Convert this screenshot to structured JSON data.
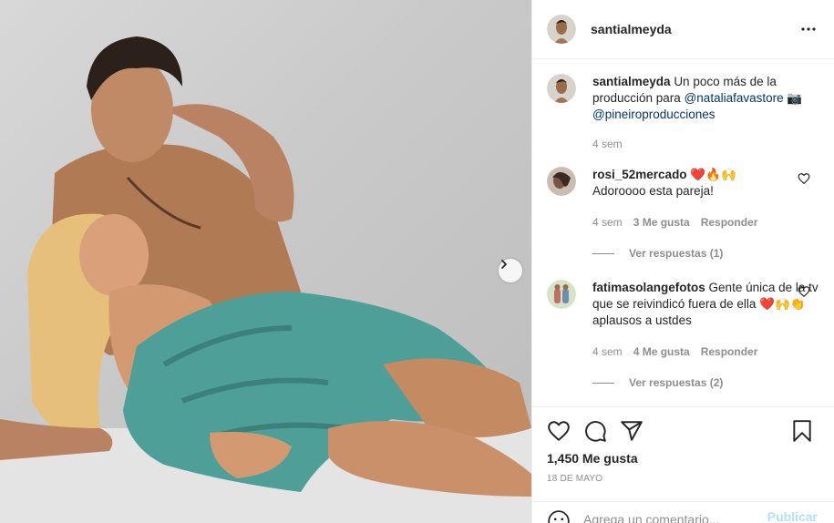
{
  "post": {
    "photo_alt": "",
    "author": "santialmeyda"
  },
  "header": {
    "username": "santialmeyda"
  },
  "caption": {
    "username": "santialmeyda",
    "text": "Un poco más de la producción para",
    "mention1": "@nataliafavastore",
    "emoji": "📷",
    "mention2": "@pineiroproducciones",
    "time": "4 sem"
  },
  "comments": [
    {
      "username": "rosi_52mercado",
      "emojis": "❤️🔥🙌",
      "text": "Adoroooo esta pareja!",
      "time": "4 sem",
      "likes": "3 Me gusta",
      "reply": "Responder",
      "view_replies": "Ver respuestas (1)"
    },
    {
      "username": "fatimasolangefotos",
      "text": "Gente única de la tv que se reivindicó fuera de ella",
      "emojis": "❤️🙌👏",
      "text_end": "aplausos a ustdes",
      "time": "4 sem",
      "likes": "4 Me gusta",
      "reply": "Responder",
      "view_replies": "Ver respuestas (2)"
    }
  ],
  "actions": {
    "like_icon": "heart-icon",
    "comment_icon": "comment-icon",
    "share_icon": "share-icon",
    "save_icon": "bookmark-icon",
    "likes_count": "1,450 Me gusta",
    "date": "18 DE MAYO"
  },
  "composer": {
    "placeholder": "Agrega un comentario...",
    "publish_label": "Publicar"
  },
  "colors": {
    "link": "#00376b",
    "heart": "#ed4956",
    "publish_disabled": "#b2dffc",
    "muted": "#8e8e8e"
  }
}
